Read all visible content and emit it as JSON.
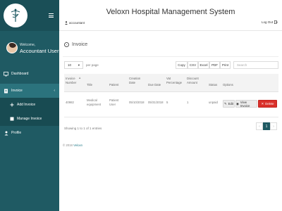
{
  "app": {
    "title": "Veloxn Hospital Management System"
  },
  "sidebar": {
    "welcome": "Welcome,",
    "user_name": "Accountant User",
    "items": [
      {
        "label": "Dashboard",
        "icon": "monitor-icon"
      },
      {
        "label": "Invoice",
        "icon": "invoice-icon",
        "caret": "‹"
      },
      {
        "label": "Add Invoice",
        "icon": "plus-icon"
      },
      {
        "label": "Manage Invoice",
        "icon": "list-icon"
      },
      {
        "label": "Profile",
        "icon": "user-icon"
      }
    ]
  },
  "topbar": {
    "account": "accountant",
    "logout": "Log Out"
  },
  "page": {
    "heading": "Invoice"
  },
  "table_controls": {
    "length_value": "10",
    "length_label": "per page",
    "export_buttons": [
      "Copy",
      "CSV",
      "Excel",
      "PDF",
      "Print"
    ],
    "search_placeholder": "Search"
  },
  "table": {
    "columns": [
      [
        "Invoice",
        "Number"
      ],
      [
        "Title"
      ],
      [
        "Patient"
      ],
      [
        "Creation",
        "Date"
      ],
      [
        "Due Date"
      ],
      [
        "Vat",
        "Percentage"
      ],
      [
        "Discount",
        "Amount"
      ],
      [
        "Status"
      ],
      [
        "Options"
      ]
    ],
    "rows": [
      {
        "invoice_number": "40982",
        "title": [
          "Medical",
          "equipment"
        ],
        "patient": [
          "Patient",
          "User"
        ],
        "creation_date": "05/10/2018",
        "due_date": "05/31/2018",
        "vat": "5",
        "discount": "1",
        "status": "unpaid",
        "actions": {
          "edit": "Edit",
          "view": "View Invoice",
          "delete": "Delete"
        }
      }
    ],
    "info": "Showing 1 to 1 of 1 entries",
    "pager": {
      "prev": "‹",
      "current": "1",
      "next": "›"
    }
  },
  "footer": {
    "copyright": "© 2018",
    "brand": "Veloxn"
  },
  "colors": {
    "sidebar": "#1f5a63",
    "sidebar_active": "#2b737d",
    "delete": "#d9302a"
  }
}
